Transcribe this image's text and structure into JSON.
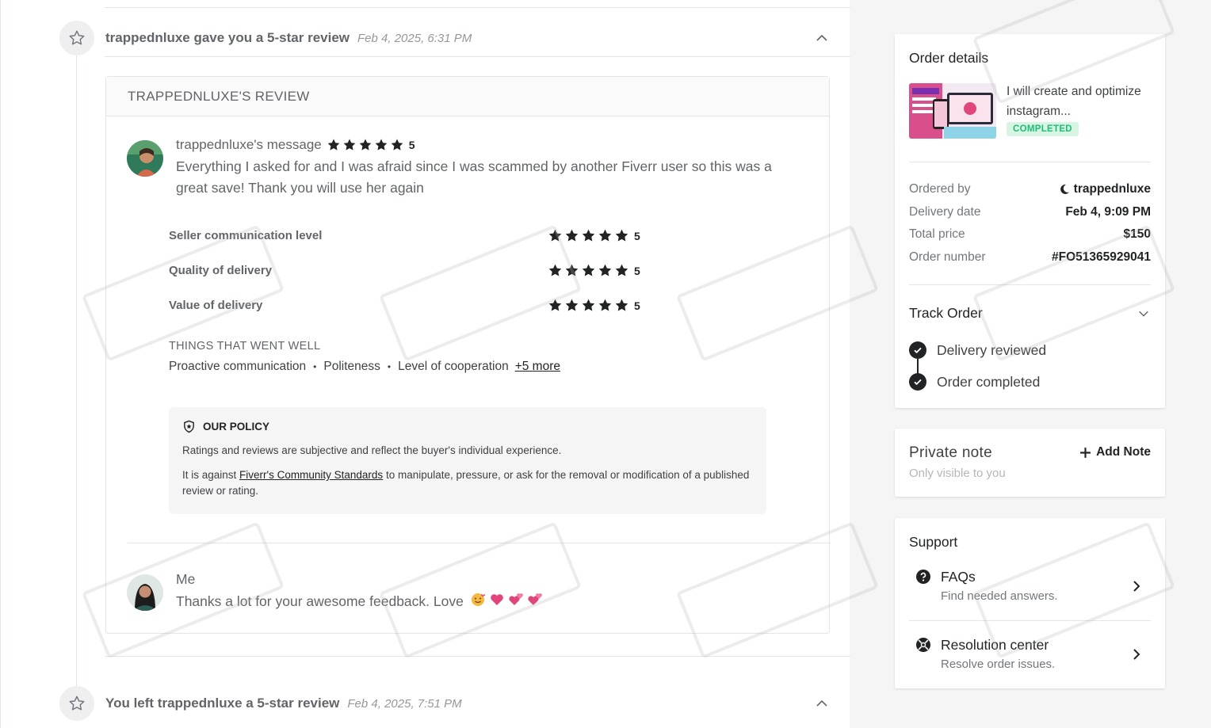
{
  "timeline": {
    "event1": {
      "title": "trappednluxe gave you a 5-star review",
      "date": "Feb 4, 2025, 6:31 PM"
    },
    "event2": {
      "title": "You left trappednluxe a 5-star review",
      "date": "Feb 4, 2025, 7:51 PM"
    }
  },
  "review": {
    "header": "TRAPPEDNLUXE'S REVIEW",
    "author": "trappednluxe's message",
    "overall_rating": "5",
    "message": "Everything I asked for and I was afraid since I was scammed by another Fiverr user so this was a great save! Thank you will use her again",
    "ratings": [
      {
        "label": "Seller communication level",
        "value": "5"
      },
      {
        "label": "Quality of delivery",
        "value": "5"
      },
      {
        "label": "Value of delivery",
        "value": "5"
      }
    ],
    "went_well_title": "THINGS THAT WENT WELL",
    "went_well": [
      "Proactive communication",
      "Politeness",
      "Level of cooperation"
    ],
    "more_link": "+5 more",
    "policy": {
      "title": "OUR POLICY",
      "p1": "Ratings and reviews are subjective and reflect the buyer's individual experience.",
      "p2_before": "It is against ",
      "p2_link": "Fiverr's Community Standards",
      "p2_after": " to manipulate, pressure, or ask for the removal or modification of a published review or rating."
    },
    "reply": {
      "name": "Me",
      "text": "Thanks a lot for your awesome feedback. Love"
    }
  },
  "order": {
    "title": "Order details",
    "gig_title": "I will create and optimize instagram...",
    "status": "COMPLETED",
    "details": [
      {
        "label": "Ordered by",
        "value": "trappednluxe"
      },
      {
        "label": "Delivery date",
        "value": "Feb 4, 9:09 PM"
      },
      {
        "label": "Total price",
        "value": "$150"
      },
      {
        "label": "Order number",
        "value": "#FO51365929041"
      }
    ],
    "track_title": "Track Order",
    "track_steps": [
      "Delivery reviewed",
      "Order completed"
    ]
  },
  "note": {
    "title": "Private note",
    "subtitle": "Only visible to you",
    "add_label": "Add Note"
  },
  "support": {
    "title": "Support",
    "items": [
      {
        "label": "FAQs",
        "desc": "Find needed answers."
      },
      {
        "label": "Resolution center",
        "desc": "Resolve order issues."
      }
    ]
  },
  "colors": {
    "accent_green": "#1dbf73",
    "badge_bg": "#d8f5e4",
    "text_dark": "#222325",
    "text_gray": "#62646a"
  },
  "watermark_text": [
    "MENTOR",
    "GENIX"
  ]
}
